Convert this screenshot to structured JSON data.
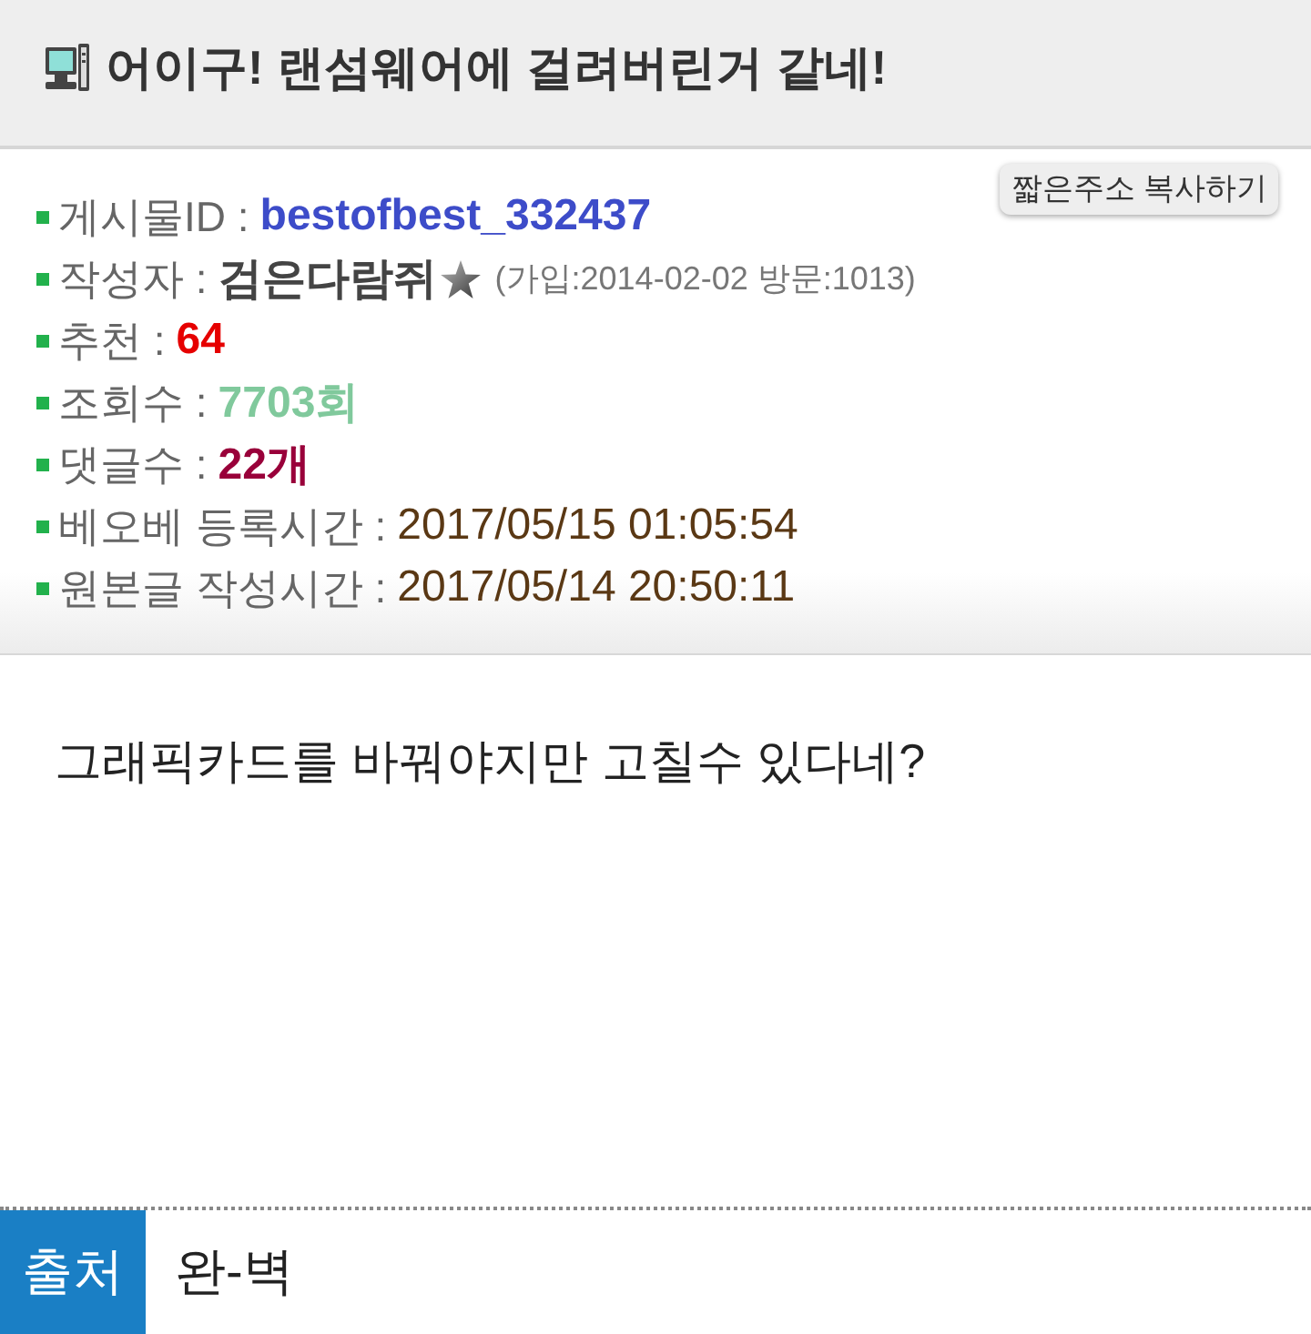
{
  "header": {
    "title": "어이구! 랜섬웨어에 걸려버린거 같네!"
  },
  "info": {
    "copy_button": "짧은주소 복사하기",
    "rows": [
      {
        "kind": "id",
        "label": "게시물ID :",
        "value": "bestofbest_332437"
      },
      {
        "kind": "author",
        "label": "작성자 :",
        "value": "검은다람쥐",
        "note": "(가입:2014-02-02 방문:1013)"
      },
      {
        "kind": "recommend",
        "label": "추천 :",
        "value": "64"
      },
      {
        "kind": "views",
        "label": "조회수 :",
        "value": "7703회"
      },
      {
        "kind": "comments",
        "label": "댓글수 :",
        "value": "22개"
      },
      {
        "kind": "date",
        "label": "베오베 등록시간 :",
        "value": "2017/05/15 01:05:54"
      },
      {
        "kind": "date",
        "label": "원본글 작성시간 :",
        "value": "2017/05/14 20:50:11"
      }
    ]
  },
  "content": {
    "text": "그래픽카드를 바꿔야지만 고칠수 있다네?"
  },
  "source": {
    "label": "출처",
    "value": "완-벽"
  }
}
